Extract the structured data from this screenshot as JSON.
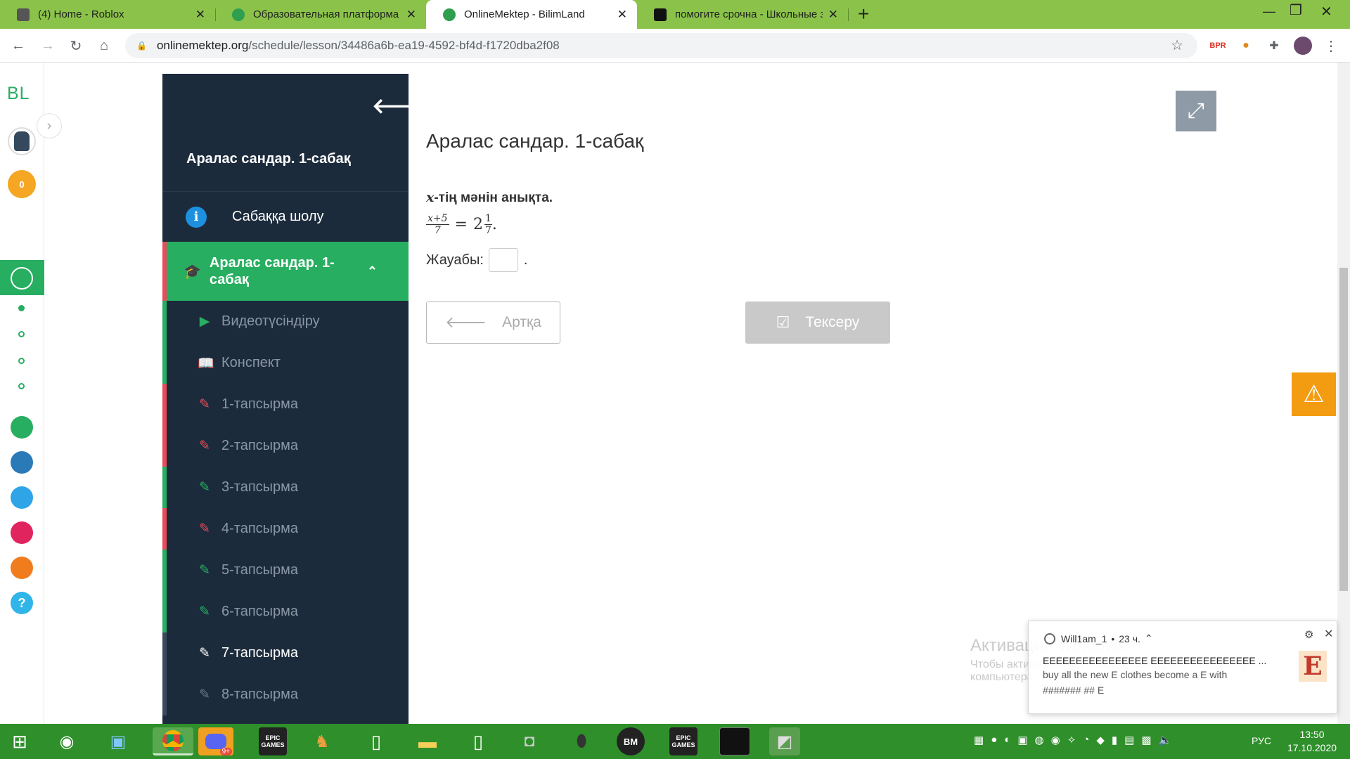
{
  "browser": {
    "tabs": [
      {
        "title": "(4) Home - Roblox",
        "color": "#555555"
      },
      {
        "title": "Образовательная платформа д",
        "color": "#2e9e4f"
      },
      {
        "title": "OnlineMektep - BilimLand",
        "color": "#2e9e4f"
      },
      {
        "title": "помогите срочна - Школьные з",
        "color": "#111111"
      }
    ],
    "new_tab": "+",
    "url_host": "onlinemektep.org",
    "url_path": "/schedule/lesson/34486a6b-ea19-4592-bf4d-f1720dba2f08",
    "ext_label": "BPR"
  },
  "rail": {
    "logo": "BL",
    "points": "0"
  },
  "sidebar": {
    "title": "Аралас сандар. 1-сабақ",
    "overview": "Сабаққа шолу",
    "lesson": "Аралас сандар. 1-сабақ",
    "items": [
      {
        "label": "Видеотүсіндіру",
        "status": "done"
      },
      {
        "label": "Конспект",
        "status": "done"
      },
      {
        "label": "1-тапсырма",
        "status": "wrong"
      },
      {
        "label": "2-тапсырма",
        "status": "wrong"
      },
      {
        "label": "3-тапсырма",
        "status": "done"
      },
      {
        "label": "4-тапсырма",
        "status": "wrong"
      },
      {
        "label": "5-тапсырма",
        "status": "done"
      },
      {
        "label": "6-тапсырма",
        "status": "done"
      },
      {
        "label": "7-тапсырма",
        "status": "current"
      },
      {
        "label": "8-тапсырма",
        "status": "none"
      }
    ],
    "status_colors": {
      "done": "#27ae60",
      "wrong": "#e74c5b",
      "current": "#ffffff",
      "none": "#3a4a5c"
    }
  },
  "main": {
    "title": "Аралас сандар. 1-сабақ",
    "question_var": "x",
    "question_text": "-тің мәнін анықта.",
    "eq_num": "x+5",
    "eq_den": "7",
    "eq_equals": "=",
    "eq_whole": "2",
    "eq_fnum": "1",
    "eq_fden": "7",
    "eq_end": ".",
    "answer_label": "Жауабы:",
    "answer_value": "",
    "answer_end": ".",
    "back_button": "Артқа",
    "check_button": "Тексеру"
  },
  "watermark": {
    "line1": "Активация Windows",
    "line2": "Чтобы активировать Windows, перейдите к параметрам",
    "line3": "компьютера."
  },
  "notification": {
    "sender": "Will1am_1",
    "time": "23 ч.",
    "line1": "EEEEEEEEEEEEEEEE EEEEEEEEEEEEEEEE ...",
    "line2": "buy all the new E clothes become a E with",
    "line3": "####### ## E",
    "avatar_letter": "E"
  },
  "taskbar": {
    "lang": "РУС",
    "time": "13:50",
    "date": "17.10.2020",
    "discord_badge": "9+",
    "epic_label": "EPIC GAMES",
    "bm_label": "BM"
  }
}
